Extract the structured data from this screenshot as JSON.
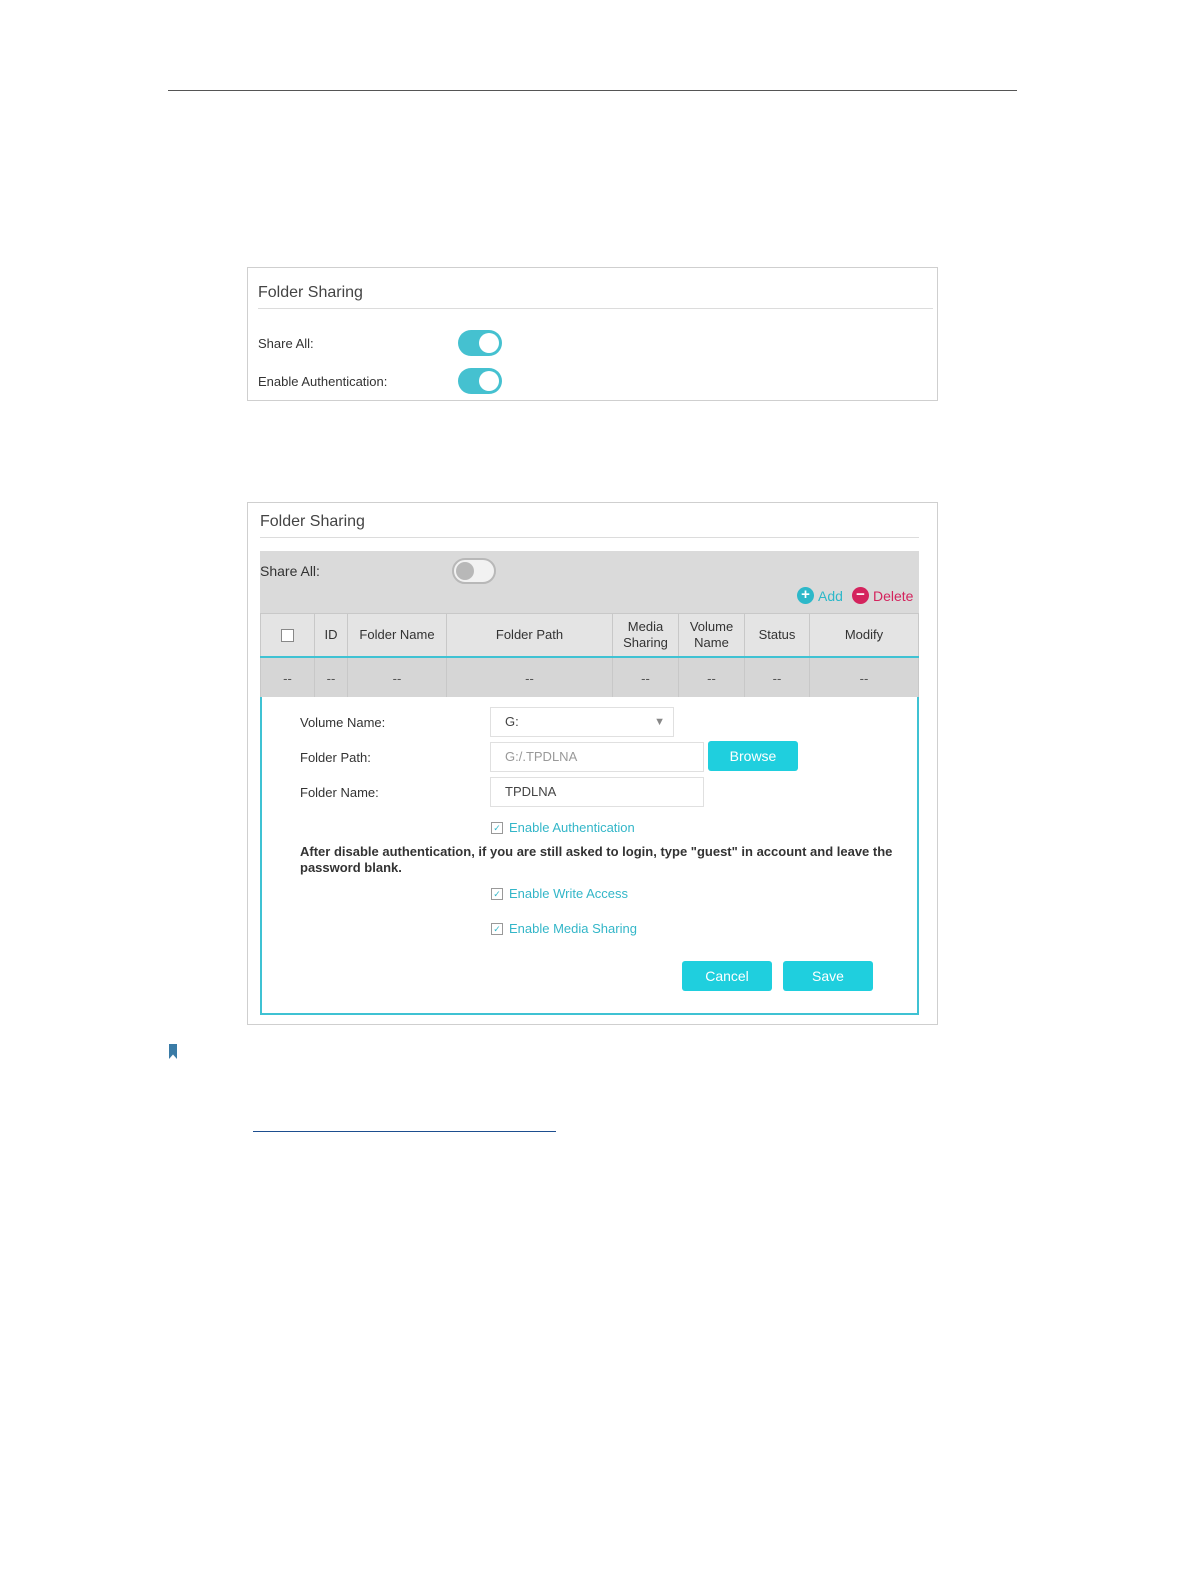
{
  "panel1": {
    "title": "Folder Sharing",
    "share_all_label": "Share All:",
    "share_all_on": true,
    "enable_auth_label": "Enable Authentication:",
    "enable_auth_on": true
  },
  "panel2": {
    "title": "Folder Sharing",
    "share_all_label": "Share All:",
    "share_all_on": false,
    "actions": {
      "add_label": "Add",
      "delete_label": "Delete",
      "add_color": "#2db8c9",
      "delete_color": "#d4235d"
    },
    "table": {
      "headers": [
        "ID",
        "Folder Name",
        "Folder Path",
        "Media Sharing",
        "Volume Name",
        "Status",
        "Modify"
      ],
      "row": [
        "--",
        "--",
        "--",
        "--",
        "--",
        "--",
        "--",
        "--"
      ]
    },
    "form": {
      "volume_label": "Volume Name:",
      "volume_value": "G:",
      "path_label": "Folder Path:",
      "path_value": "G:/.TPDLNA",
      "browse_label": "Browse",
      "name_label": "Folder Name:",
      "name_value": "TPDLNA",
      "enable_auth": "Enable Authentication",
      "warning": "After disable authentication, if you are still asked to login, type \"guest\" in account and leave the password blank.",
      "enable_write": "Enable Write Access",
      "enable_media": "Enable Media Sharing",
      "cancel_label": "Cancel",
      "save_label": "Save"
    }
  },
  "colors": {
    "accent": "#1fcfde",
    "toggle_on": "#45c1d0",
    "border_accent": "#3fc2d3"
  }
}
